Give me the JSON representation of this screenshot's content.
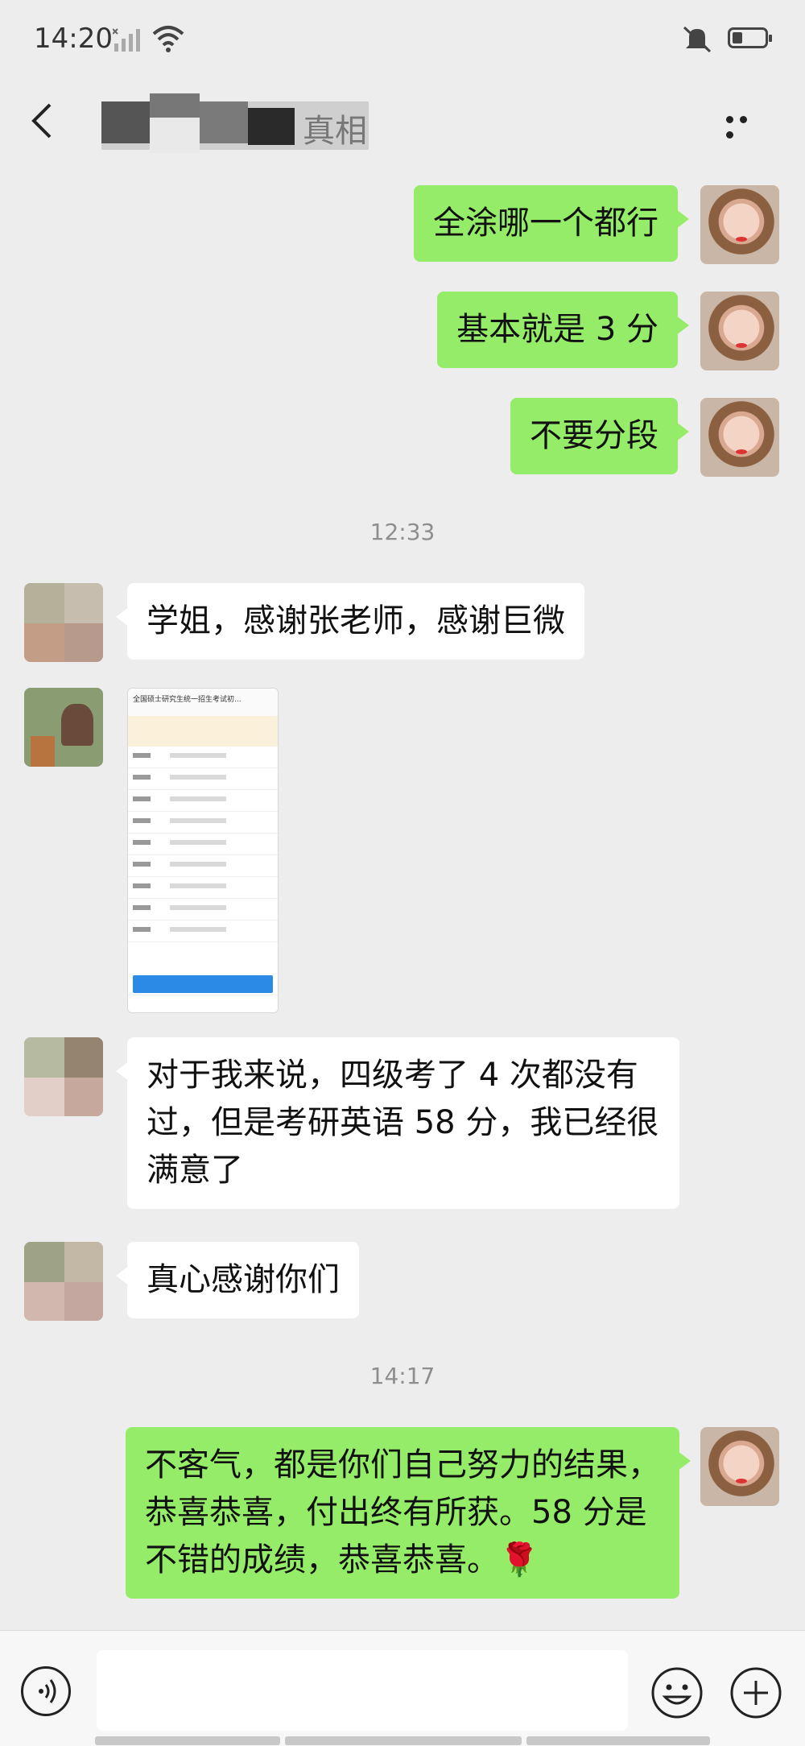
{
  "status_bar": {
    "time": "14:20"
  },
  "nav": {
    "title_visible": "真相"
  },
  "messages": [
    {
      "side": "me",
      "text": "全涂哪一个都行"
    },
    {
      "side": "me",
      "text": "基本就是 3 分"
    },
    {
      "side": "me",
      "text": "不要分段"
    },
    {
      "type": "time",
      "text": "12:33"
    },
    {
      "side": "other",
      "text": "学姐，感谢张老师，感谢巨微"
    },
    {
      "side": "other",
      "type": "image",
      "image_title": "全国硕士研究生统一招生考试初..."
    },
    {
      "side": "other",
      "text": "对于我来说，四级考了 4 次都没有过，但是考研英语 58 分，我已经很满意了"
    },
    {
      "side": "other",
      "text": "真心感谢你们"
    },
    {
      "type": "time",
      "text": "14:17"
    },
    {
      "side": "me",
      "text": "不客气，都是你们自己努力的结果，恭喜恭喜，付出终有所获。58 分是不错的成绩，恭喜恭喜。🌹"
    }
  ],
  "input": {
    "value": ""
  },
  "colors": {
    "me_bubble": "#95ec69",
    "other_bubble": "#ffffff",
    "background": "#ededed"
  },
  "icons": [
    "signal-icon",
    "wifi-icon",
    "mute-icon",
    "battery-icon",
    "back-icon",
    "more-icon",
    "voice-icon",
    "emoji-icon",
    "plus-icon"
  ]
}
